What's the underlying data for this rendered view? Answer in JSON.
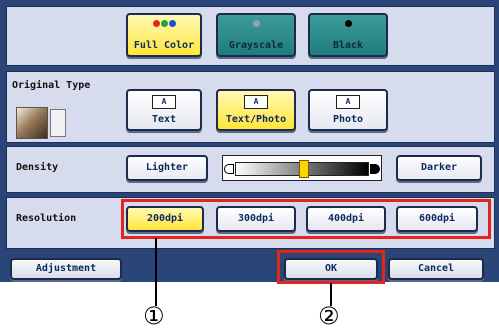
{
  "color_mode": {
    "options": [
      {
        "label": "Full Color",
        "selected": true
      },
      {
        "label": "Grayscale",
        "selected": false
      },
      {
        "label": "Black",
        "selected": false
      }
    ]
  },
  "original_type": {
    "title": "Original Type",
    "options": [
      {
        "label": "Text",
        "icon_text": "A",
        "selected": false
      },
      {
        "label": "Text/Photo",
        "icon_text": "A",
        "selected": true
      },
      {
        "label": "Photo",
        "icon_text": "A",
        "selected": false
      }
    ]
  },
  "density": {
    "title": "Density",
    "lighter": "Lighter",
    "darker": "Darker",
    "level_fraction": 0.5
  },
  "resolution": {
    "title": "Resolution",
    "options": [
      {
        "label": "200dpi",
        "selected": true
      },
      {
        "label": "300dpi",
        "selected": false
      },
      {
        "label": "400dpi",
        "selected": false
      },
      {
        "label": "600dpi",
        "selected": false
      }
    ]
  },
  "footer": {
    "adjustment": "Adjustment",
    "ok": "OK",
    "cancel": "Cancel"
  },
  "markers": {
    "first": "①",
    "second": "②"
  },
  "colors": {
    "panel": "#2a4678",
    "highlight": "#e3261c",
    "selected": "#ffe63a"
  }
}
